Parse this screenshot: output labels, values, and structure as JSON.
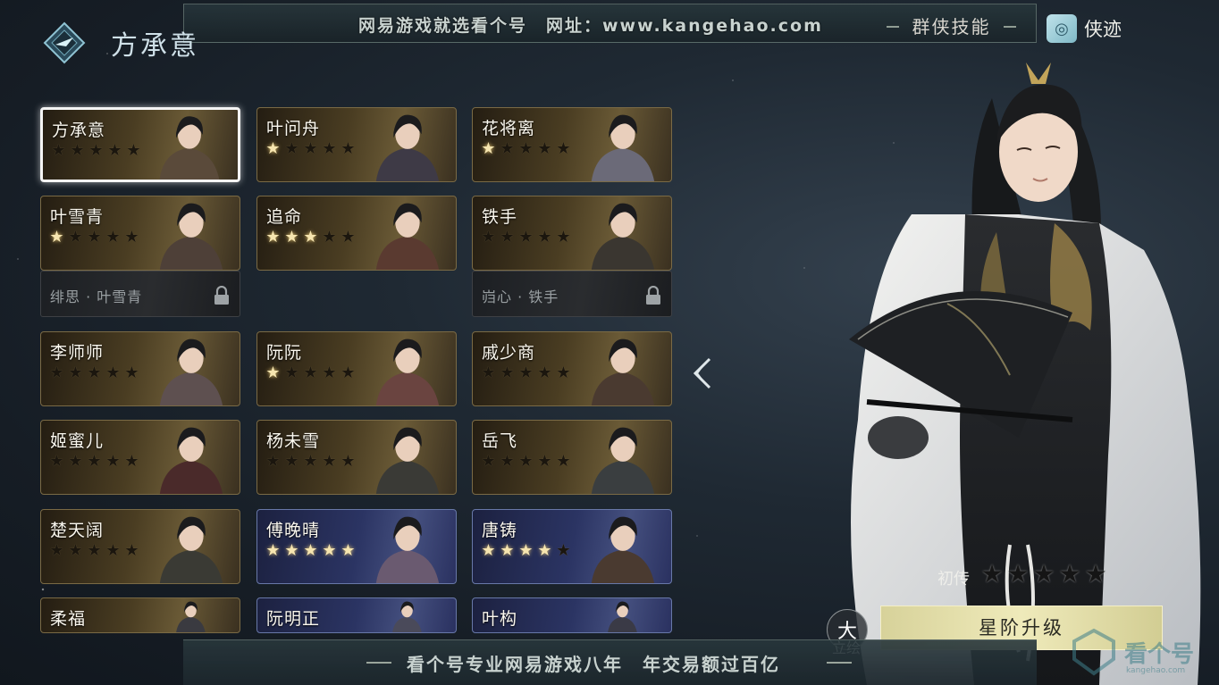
{
  "header": {
    "title": "方承意",
    "watermark": "网易游戏就选看个号　网址：www.kangehao.com",
    "skills_tab": "群侠技能",
    "traces_tab": "侠迹",
    "traces_icon_glyph": "◎"
  },
  "characters": [
    {
      "name": "方承意",
      "stars": 0,
      "theme": "gold",
      "selected": true
    },
    {
      "name": "叶问舟",
      "stars": 1,
      "theme": "gold"
    },
    {
      "name": "花将离",
      "stars": 1,
      "theme": "gold"
    },
    {
      "name": "叶雪青",
      "stars": 1,
      "theme": "gold"
    },
    {
      "name": "追命",
      "stars": 3,
      "theme": "gold"
    },
    {
      "name": "铁手",
      "stars": 0,
      "theme": "gold"
    },
    {
      "name": "李师师",
      "stars": 0,
      "theme": "gold"
    },
    {
      "name": "阮阮",
      "stars": 1,
      "theme": "gold"
    },
    {
      "name": "戚少商",
      "stars": 0,
      "theme": "gold"
    },
    {
      "name": "姬蜜儿",
      "stars": 0,
      "theme": "gold"
    },
    {
      "name": "杨未雪",
      "stars": 0,
      "theme": "gold"
    },
    {
      "name": "岳飞",
      "stars": 0,
      "theme": "gold"
    },
    {
      "name": "楚天阔",
      "stars": 0,
      "theme": "gold"
    },
    {
      "name": "傅晚晴",
      "stars": 5,
      "theme": "blue"
    },
    {
      "name": "唐铸",
      "stars": 4,
      "theme": "blue"
    },
    {
      "name": "柔福",
      "stars": 0,
      "theme": "gold"
    },
    {
      "name": "阮明正",
      "stars": 0,
      "theme": "blue"
    },
    {
      "name": "叶构",
      "stars": 0,
      "theme": "blue"
    }
  ],
  "locked_variants": [
    {
      "name": "绯思 · 叶雪青"
    },
    {
      "name": "岿心 · 铁手"
    }
  ],
  "hero": {
    "stage_label": "初传",
    "stars": 5,
    "upgrade_button": "星阶升级",
    "portrait_toggle_label": "立绘",
    "portrait_toggle_glyph": "⼤"
  },
  "footer": {
    "promo": "看个号专业网易游戏八年　年交易额过百亿"
  },
  "corner_logo": {
    "text": "看个号",
    "sub": "kangehao.com"
  },
  "icons": {
    "star": "★",
    "lock": "lock-icon",
    "back": "chevron-left-icon"
  },
  "colors": {
    "gold_card": "#4a3d22",
    "blue_card": "#2b3463",
    "star_on": "#f6e5b0",
    "button": "#efeaba"
  }
}
